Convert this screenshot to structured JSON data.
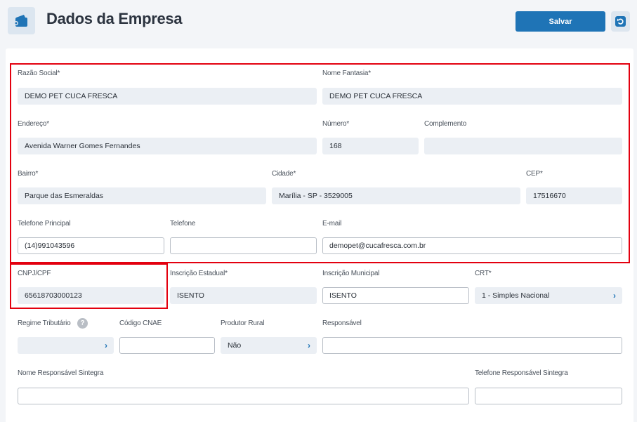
{
  "header": {
    "title": "Dados da Empresa",
    "save_label": "Salvar"
  },
  "icons": {
    "app": "wallet-icon",
    "back": "undo-icon"
  },
  "colors": {
    "primary": "#1f74b6",
    "highlight": "#e3000f",
    "readonly_bg": "#ebeff4"
  },
  "form": {
    "razao_social": {
      "label": "Razão Social*",
      "value": "DEMO PET CUCA FRESCA"
    },
    "nome_fantasia": {
      "label": "Nome Fantasia*",
      "value": "DEMO PET CUCA FRESCA"
    },
    "endereco": {
      "label": "Endereço*",
      "value": "Avenida Warner Gomes Fernandes"
    },
    "numero": {
      "label": "Número*",
      "value": "168"
    },
    "complemento": {
      "label": "Complemento",
      "value": ""
    },
    "bairro": {
      "label": "Bairro*",
      "value": "Parque das Esmeraldas"
    },
    "cidade": {
      "label": "Cidade*",
      "value": "Marília - SP - 3529005"
    },
    "cep": {
      "label": "CEP*",
      "value": "17516670"
    },
    "telefone_principal": {
      "label": "Telefone Principal",
      "value": "(14)991043596"
    },
    "telefone": {
      "label": "Telefone",
      "value": ""
    },
    "email": {
      "label": "E-mail",
      "value": "demopet@cucafresca.com.br"
    },
    "cnpj": {
      "label": "CNPJ/CPF",
      "value": "65618703000123"
    },
    "inscricao_estadual": {
      "label": "Inscrição Estadual*",
      "value": "ISENTO"
    },
    "inscricao_municipal": {
      "label": "Inscrição Municipal",
      "value": "ISENTO"
    },
    "crt": {
      "label": "CRT*",
      "value": "1 - Simples Nacional"
    },
    "regime_tributario": {
      "label": "Regime Tributário",
      "value": "",
      "help": "?"
    },
    "codigo_cnae": {
      "label": "Código CNAE",
      "value": ""
    },
    "produtor_rural": {
      "label": "Produtor Rural",
      "value": "Não"
    },
    "responsavel": {
      "label": "Responsável",
      "value": ""
    },
    "nome_responsavel_sintegra": {
      "label": "Nome Responsável Sintegra",
      "value": ""
    },
    "telefone_responsavel_sintegra": {
      "label": "Telefone Responsável Sintegra",
      "value": ""
    }
  }
}
